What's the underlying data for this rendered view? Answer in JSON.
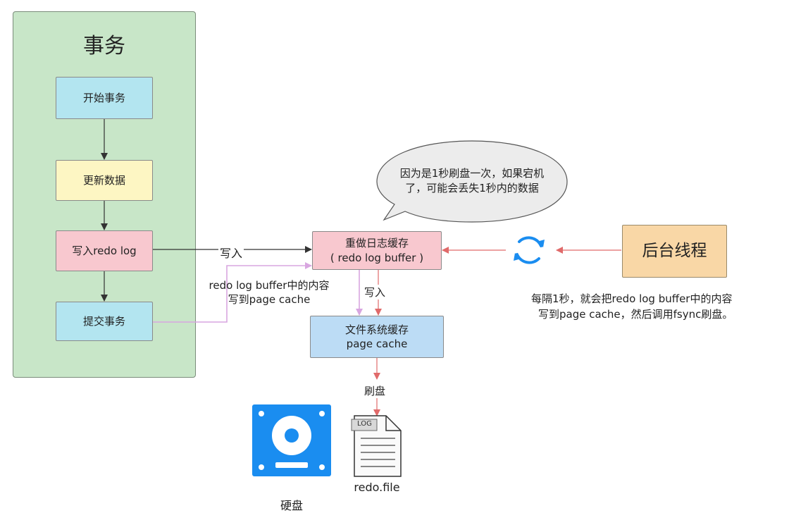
{
  "transaction": {
    "title": "事务",
    "steps": {
      "start": "开始事务",
      "update": "更新数据",
      "write_redo": "写入redo log",
      "commit": "提交事务"
    }
  },
  "buffer": {
    "line1": "重做日志缓存",
    "line2": "( redo log buffer )"
  },
  "page_cache": {
    "line1": "文件系统缓存",
    "line2": "page cache"
  },
  "thread": {
    "label": "后台线程"
  },
  "bubble": {
    "line1": "因为是1秒刷盘一次，如果宕机",
    "line2": "了，可能会丢失1秒内的数据"
  },
  "edge_labels": {
    "write_in": "写入",
    "write_in_down": "写入",
    "commit_line1": "redo log buffer中的内容",
    "commit_line2": "写到page cache",
    "flush": "刷盘"
  },
  "thread_note": {
    "line1": "每隔1秒，就会把redo log buffer中的内容",
    "line2": "写到page cache，然后调用fsync刷盘。"
  },
  "disk": {
    "label": "硬盘",
    "icon": "hard-disk-icon",
    "color": "#1a8df0"
  },
  "file": {
    "label": "redo.file",
    "tag": "LOG",
    "icon": "log-file-icon"
  },
  "sync_icon": {
    "icon": "sync-icon",
    "color": "#1a8df0"
  },
  "colors": {
    "red_arrow": "#e06a6a",
    "purple_arrow": "#d8a6e0",
    "black_arrow": "#333333"
  }
}
